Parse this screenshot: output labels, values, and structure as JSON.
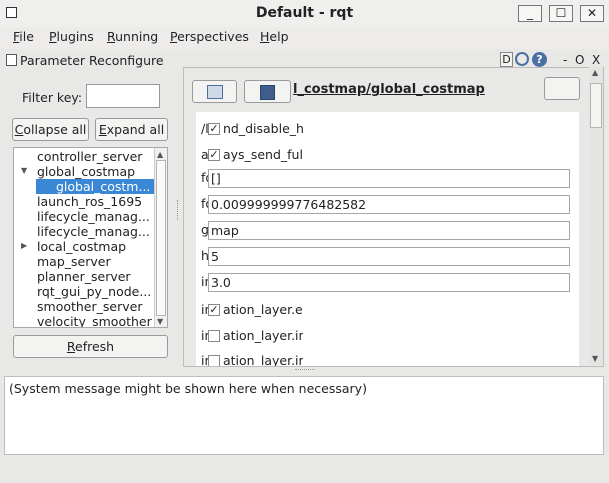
{
  "window": {
    "title": "Default - rqt",
    "minimize_glyph": "_",
    "maximize_glyph": "☐",
    "close_glyph": "✕"
  },
  "menu": [
    "File",
    "Plugins",
    "Running",
    "Perspectives",
    "Help"
  ],
  "plugin": {
    "title": "Parameter Reconfigure",
    "d_label": "D",
    "dash": "-",
    "o": "O",
    "x": "X"
  },
  "left": {
    "filter_label": "Filter key:",
    "filter_value": "",
    "collapse_label": "Collapse all",
    "expand_label": "Expand all",
    "refresh_label": "Refresh",
    "tree": [
      {
        "label": "controller_server",
        "indent": 0
      },
      {
        "label": "global_costmap",
        "indent": 0,
        "expanded": true
      },
      {
        "label": "global_costm...",
        "indent": 1,
        "selected": true
      },
      {
        "label": "launch_ros_1695",
        "indent": 0
      },
      {
        "label": "lifecycle_manag...",
        "indent": 0
      },
      {
        "label": "lifecycle_manag...",
        "indent": 0
      },
      {
        "label": "local_costmap",
        "indent": 0,
        "collapsed": true
      },
      {
        "label": "map_server",
        "indent": 0
      },
      {
        "label": "planner_server",
        "indent": 0
      },
      {
        "label": "rqt_gui_py_node...",
        "indent": 0
      },
      {
        "label": "smoother_server",
        "indent": 0
      },
      {
        "label": "velocity_smoother",
        "indent": 0
      }
    ]
  },
  "right": {
    "node_path": "l_costmap/global_costmap",
    "params": [
      {
        "label": "/l",
        "suffix": "nd_disable_he",
        "type": "check",
        "checked": true
      },
      {
        "label": "a",
        "suffix": "ays_send_full",
        "type": "check",
        "checked": true
      },
      {
        "label": "fo",
        "type": "text",
        "value": "[]"
      },
      {
        "label": "fo",
        "type": "text",
        "value": "0.009999999776482582"
      },
      {
        "label": "g",
        "type": "text",
        "value": "map"
      },
      {
        "label": "h",
        "type": "text",
        "value": "5"
      },
      {
        "label": "in",
        "type": "text",
        "value": "3.0"
      },
      {
        "label": "in",
        "suffix": "ation_layer.er",
        "type": "check",
        "checked": true
      },
      {
        "label": "in",
        "suffix": "ation_layer.int",
        "type": "check",
        "checked": false
      },
      {
        "label": "in",
        "suffix": "ation_layer.int",
        "type": "check",
        "checked": false
      }
    ]
  },
  "status": {
    "message": "(System message might be shown here when necessary)"
  }
}
